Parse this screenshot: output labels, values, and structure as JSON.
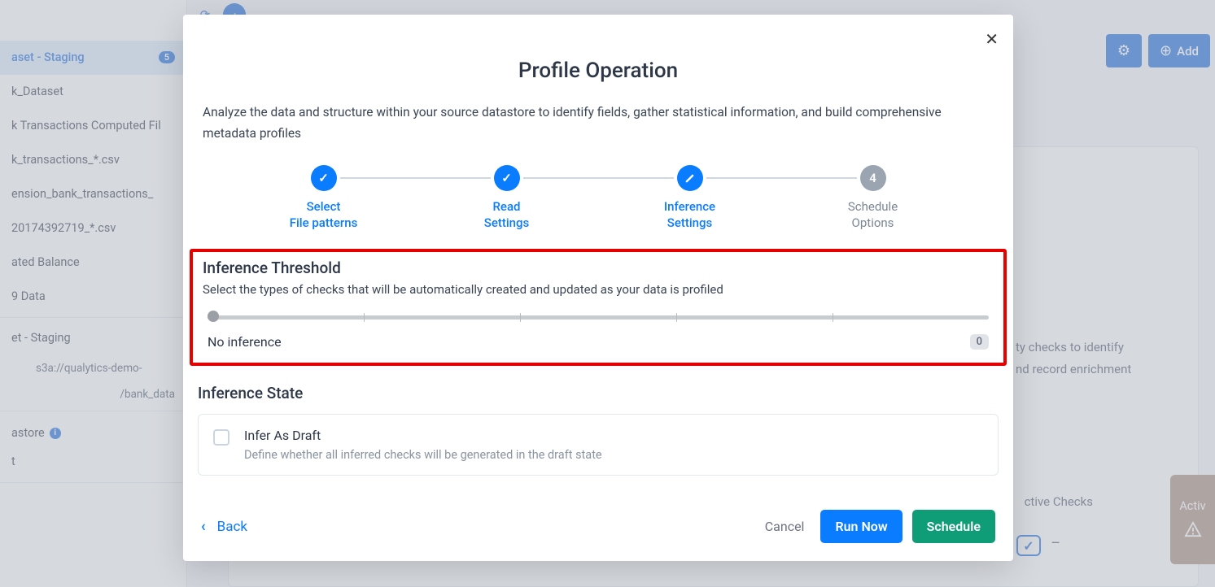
{
  "sidebar": {
    "items": [
      {
        "label": "aset - Staging",
        "badge": "5",
        "active": true
      },
      {
        "label": "k_Dataset"
      },
      {
        "label": "k Transactions Computed Fil"
      },
      {
        "label": "k_transactions_*.csv"
      },
      {
        "label": "ension_bank_transactions_"
      },
      {
        "label": "20174392719_*.csv"
      },
      {
        "label": "ated Balance"
      },
      {
        "label": "9 Data"
      }
    ],
    "secondary_label": "et - Staging",
    "sub1": "s3a://qualytics-demo-",
    "sub2": "/bank_data",
    "heading": "astore",
    "row": "t"
  },
  "topright": {
    "add": "Add"
  },
  "content": {
    "line1": "ty checks to identify",
    "line2": "nd record enrichment",
    "active_checks": "ctive Checks",
    "activity": "Activ"
  },
  "modal": {
    "title": "Profile Operation",
    "description": "Analyze the data and structure within your source datastore to identify fields, gather statistical information, and build comprehensive metadata profiles",
    "steps": [
      {
        "line1": "Select",
        "line2": "File patterns",
        "state": "done"
      },
      {
        "line1": "Read",
        "line2": "Settings",
        "state": "done"
      },
      {
        "line1": "Inference",
        "line2": "Settings",
        "state": "current"
      },
      {
        "line1": "Schedule",
        "line2": "Options",
        "state": "pending",
        "num": "4"
      }
    ],
    "threshold": {
      "heading": "Inference Threshold",
      "sub": "Select the types of checks that will be automatically created and updated as your data is profiled",
      "value_label": "No inference",
      "chip": "0"
    },
    "state": {
      "heading": "Inference State",
      "card_title": "Infer As Draft",
      "card_sub": "Define whether all inferred checks will be generated in the draft state"
    },
    "footer": {
      "back": "Back",
      "cancel": "Cancel",
      "run": "Run Now",
      "schedule": "Schedule"
    }
  }
}
